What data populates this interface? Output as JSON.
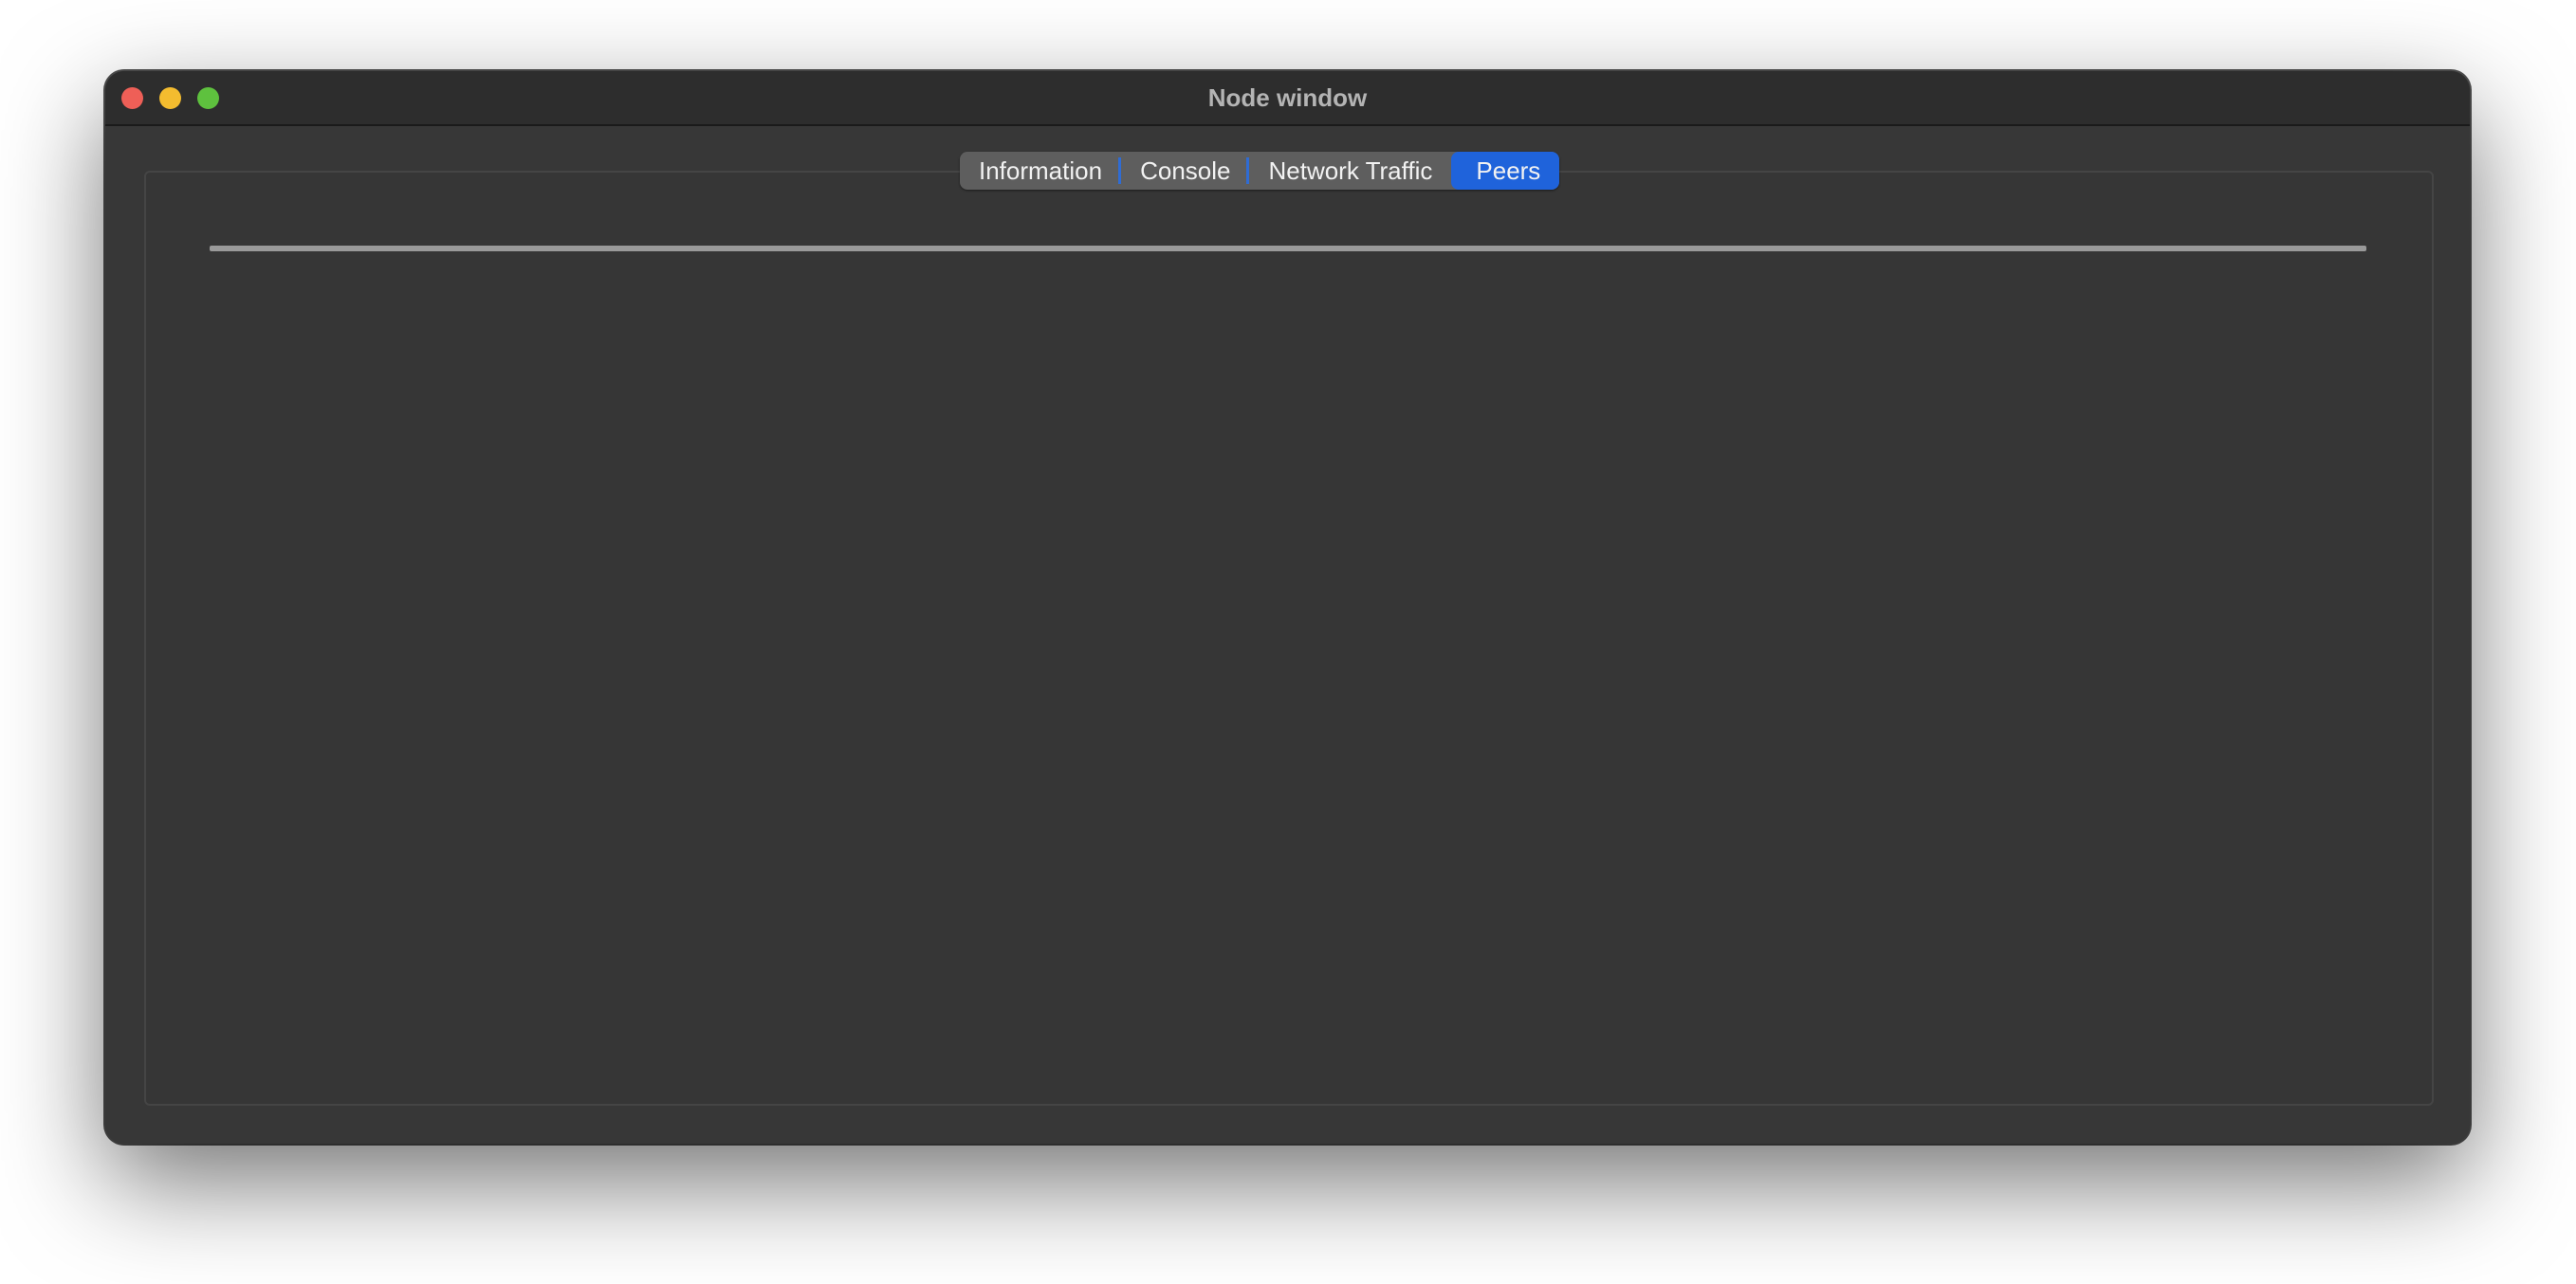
{
  "window": {
    "title": "Node window"
  },
  "tabs": [
    {
      "label": "Information",
      "active": false
    },
    {
      "label": "Console",
      "active": false
    },
    {
      "label": "Network Traffic",
      "active": false
    },
    {
      "label": "Peers",
      "active": true
    }
  ],
  "colors": {
    "accent": "#1f63db",
    "close": "#ee5f57",
    "minimize": "#f3bc2f",
    "zoom": "#5ec13e",
    "window_bg": "#373737"
  }
}
